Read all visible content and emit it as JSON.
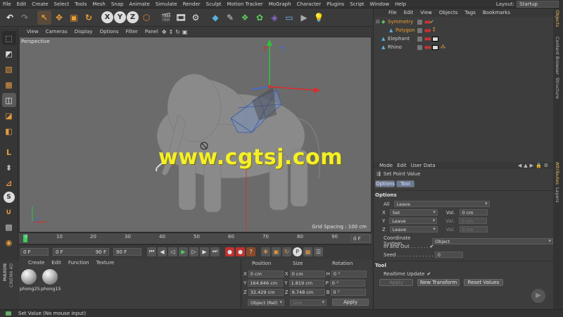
{
  "menubar": {
    "items": [
      "File",
      "Edit",
      "Create",
      "Select",
      "Tools",
      "Mesh",
      "Snap",
      "Animate",
      "Simulate",
      "Render",
      "Sculpt",
      "Motion Tracker",
      "MoGraph",
      "Character",
      "Plugins",
      "Script",
      "Window",
      "Help"
    ],
    "layout_label": "Layout:",
    "layout_value": "Startup"
  },
  "viewport": {
    "menu": [
      "View",
      "Cameras",
      "Display",
      "Options",
      "Filter",
      "Panel"
    ],
    "camera_label": "Perspective",
    "grid_spacing": "Grid Spacing : 100 cm",
    "watermark": "www.cgtsj.com"
  },
  "timeline": {
    "ticks": [
      "0",
      "10",
      "20",
      "30",
      "40",
      "50",
      "60",
      "70",
      "80",
      "90"
    ],
    "end_frame": "0 F",
    "current_frame": "0 F",
    "range_start": "0 F",
    "range_end": "90 F",
    "max_frame": "90 F"
  },
  "materials": {
    "menu": [
      "Create",
      "Edit",
      "Function",
      "Texture"
    ],
    "items": [
      "phong25",
      "phong15"
    ]
  },
  "coordinates": {
    "headers": [
      "Position",
      "Size",
      "Rotation"
    ],
    "rows": [
      {
        "pos_axis": "X",
        "pos": "0 cm",
        "size_axis": "X",
        "size": "0 cm",
        "rot_axis": "H",
        "rot": "0 °"
      },
      {
        "pos_axis": "Y",
        "pos": "164.846 cm",
        "size_axis": "Y",
        "size": "1.819 cm",
        "rot_axis": "P",
        "rot": "0 °"
      },
      {
        "pos_axis": "Z",
        "pos": "32.429 cm",
        "size_axis": "Z",
        "size": "9.748 cm",
        "rot_axis": "B",
        "rot": "0 °"
      }
    ],
    "mode": "Object (Rel)",
    "size_mode": "Size",
    "apply_label": "Apply"
  },
  "objects": {
    "menu": [
      "File",
      "Edit",
      "View",
      "Objects",
      "Tags",
      "Bookmarks"
    ],
    "items": [
      {
        "name": "Symmetry",
        "color": "#e8a030"
      },
      {
        "name": "Polygon",
        "color": "#e8a030"
      },
      {
        "name": "Elephant",
        "color": "#d0d0d0"
      },
      {
        "name": "Rhino",
        "color": "#d0d0d0"
      }
    ]
  },
  "attributes": {
    "tabs": [
      "Mode",
      "Edit",
      "User Data"
    ],
    "tool_name": "Set Point Value",
    "subtabs": [
      "Options",
      "Tool"
    ],
    "options_header": "Options",
    "all_label": "All",
    "all_value": "Leave",
    "axis_rows": [
      {
        "axis": "X",
        "mode": "Set",
        "val_label": "Val.",
        "val": "0 cm"
      },
      {
        "axis": "Y",
        "mode": "Leave",
        "val_label": "Val.",
        "val": "0 cm"
      },
      {
        "axis": "Z",
        "mode": "Leave",
        "val_label": "Val.",
        "val": "0 cm"
      }
    ],
    "coord_system_label": "Coordinate System",
    "coord_system_value": "Object",
    "in_and_out_label": "In and Out . . . . . .",
    "seed_label": "Seed . . . . . . . . . . . .",
    "seed_value": "0",
    "tool_header": "Tool",
    "realtime_label": "Realtime Update",
    "apply_btn": "Apply",
    "new_transform_btn": "New Transform",
    "reset_values_btn": "Reset Values"
  },
  "right_tabs": [
    "Objects",
    "Content Browser",
    "Structure",
    "Attributes",
    "Layers"
  ],
  "status": {
    "text": "Set Value (No mouse input)"
  },
  "branding": {
    "maxon": "MAXON",
    "product": "CINEMA 4D"
  },
  "colors": {
    "accent_orange": "#e8a030",
    "viewport_bg": "#6b6b6b",
    "watermark": "#f4ef2a"
  }
}
